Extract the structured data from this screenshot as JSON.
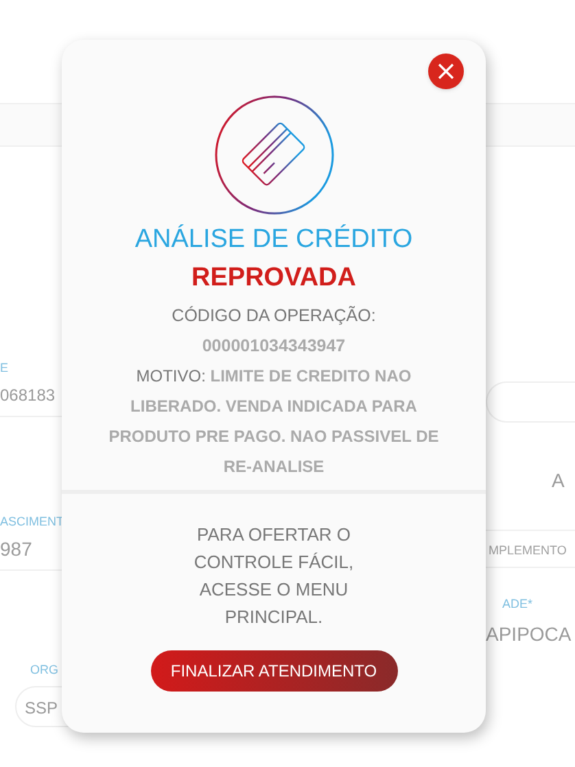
{
  "background_form": {
    "left": [
      {
        "kind": "label",
        "text": "E"
      },
      {
        "kind": "value",
        "text": "068183"
      },
      {
        "kind": "label",
        "text": "ASCIMENT"
      },
      {
        "kind": "value",
        "text": "987"
      },
      {
        "kind": "label",
        "text": "ORG"
      },
      {
        "kind": "select",
        "text": "SSP"
      }
    ],
    "right": [
      {
        "kind": "field"
      },
      {
        "kind": "value",
        "text": "A"
      },
      {
        "kind": "placeholder",
        "text": "MPLEMENTO"
      },
      {
        "kind": "label",
        "text": "ADE*"
      },
      {
        "kind": "value",
        "text": "APIPOCA"
      }
    ]
  },
  "modal": {
    "title": "ANÁLISE DE CRÉDITO",
    "status": "REPROVADA",
    "code_label": "CÓDIGO DA OPERAÇÃO:",
    "code": "000001034343947",
    "reason": "MOTIVO: **LIMITE DE CREDITO NAO LIBERADO. VENDA INDICADA PARA PRODUTO PRE PAGO. NAO PASSIVEL DE RE-ANALISE**",
    "offer_text": "PARA OFERTAR O CONTROLE FÁCIL, ACESSE O MENU PRINCIPAL.",
    "button": "FINALIZAR ATENDIMENTO"
  }
}
